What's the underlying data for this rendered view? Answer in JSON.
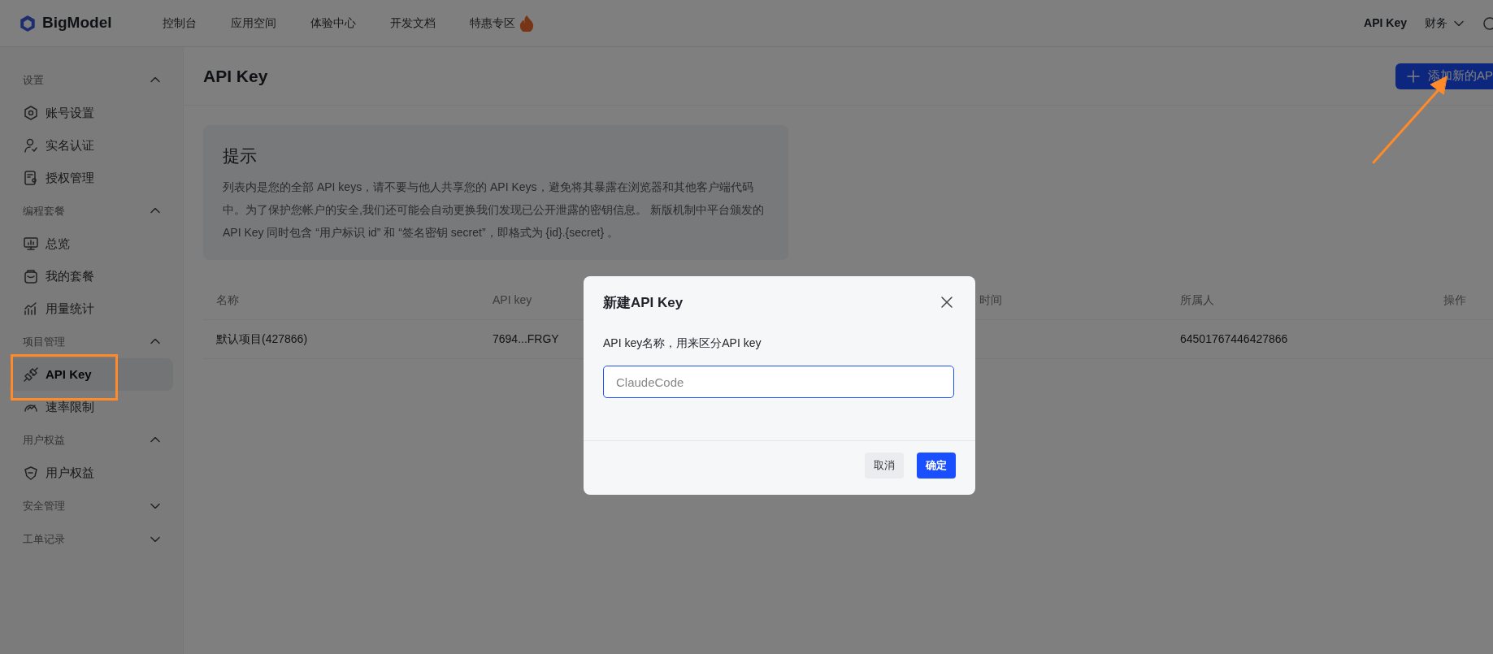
{
  "topbar": {
    "logo": "BigModel",
    "nav": [
      {
        "label": "控制台",
        "hot": false
      },
      {
        "label": "应用空间",
        "hot": false
      },
      {
        "label": "体验中心",
        "hot": false
      },
      {
        "label": "开发文档",
        "hot": false
      },
      {
        "label": "特惠专区",
        "hot": true
      }
    ],
    "right": [
      {
        "label": "API Key",
        "kind": "bold"
      },
      {
        "label": "财务",
        "kind": "dropdown"
      }
    ]
  },
  "sidebar": {
    "groups": [
      {
        "title": "设置",
        "expanded": true,
        "items": [
          {
            "label": "账号设置",
            "selected": false
          },
          {
            "label": "实名认证",
            "selected": false
          },
          {
            "label": "授权管理",
            "selected": false
          }
        ]
      },
      {
        "title": "编程套餐",
        "expanded": true,
        "items": [
          {
            "label": "总览",
            "selected": false
          },
          {
            "label": "我的套餐",
            "selected": false
          },
          {
            "label": "用量统计",
            "selected": false
          }
        ]
      },
      {
        "title": "项目管理",
        "expanded": true,
        "items": [
          {
            "label": "API Key",
            "selected": true
          },
          {
            "label": "速率限制",
            "selected": false
          }
        ]
      },
      {
        "title": "用户权益",
        "expanded": true,
        "items": [
          {
            "label": "用户权益",
            "selected": false
          }
        ]
      },
      {
        "title": "安全管理",
        "expanded": false
      },
      {
        "title": "工单记录",
        "expanded": false
      }
    ]
  },
  "page": {
    "title": "API Key",
    "add_button": "添加新的AP"
  },
  "notice": {
    "title": "提示",
    "text": "列表内是您的全部 API keys，请不要与他人共享您的 API Keys，避免将其暴露在浏览器和其他客户端代码中。为了保护您帐户的安全,我们还可能会自动更换我们发现已公开泄露的密钥信息。 新版机制中平台颁发的 API Key 同时包含 “用户标识 id” 和 “签名密钥 secret”，即格式为 {id}.{secret} 。"
  },
  "table": {
    "columns": [
      "名称",
      "API key",
      "时间",
      "所属人",
      "操作"
    ],
    "rows": [
      [
        "默认项目(427866)",
        "7694...FRGY",
        "",
        "64501767446427866",
        ""
      ]
    ]
  },
  "dialog": {
    "title": "新建API Key",
    "label": "API key名称，用来区分API key",
    "placeholder": "ClaudeCode",
    "cancel": "取消",
    "confirm": "确定"
  }
}
